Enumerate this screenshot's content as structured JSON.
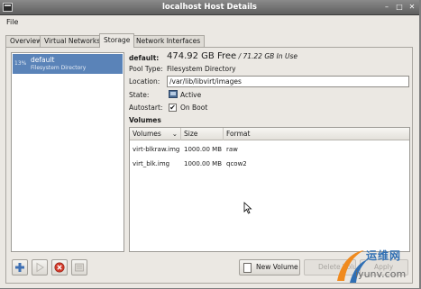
{
  "window": {
    "title": "localhost Host Details"
  },
  "menubar": {
    "file": "File"
  },
  "tabs": [
    {
      "label": "Overview"
    },
    {
      "label": "Virtual Networks"
    },
    {
      "label": "Storage"
    },
    {
      "label": "Network Interfaces"
    }
  ],
  "active_tab": "Storage",
  "pools": [
    {
      "usage": "13%",
      "name": "default",
      "type": "Filesystem Directory"
    }
  ],
  "details": {
    "name_label": "default:",
    "size_free": "474.92 GB Free",
    "size_usage": " / 71.22 GB In Use",
    "pool_type_label": "Pool Type:",
    "pool_type_value": "Filesystem Directory",
    "location_label": "Location:",
    "location_value": "/var/lib/libvirt/images",
    "state_label": "State:",
    "state_value": "Active",
    "autostart_label": "Autostart:",
    "autostart_value": "On Boot",
    "autostart_checked": "✔",
    "volumes_label": "Volumes"
  },
  "volumes": {
    "columns": [
      "Volumes",
      "Size",
      "Format"
    ],
    "rows": [
      {
        "name": "virt-blkraw.img",
        "size": "1000.00 MB",
        "format": "raw"
      },
      {
        "name": "virt_blk.img",
        "size": "1000.00 MB",
        "format": "qcow2"
      }
    ]
  },
  "buttons": {
    "new_volume": "New Volume",
    "delete_volume": "Delete Volume",
    "apply": "Apply"
  },
  "watermark": {
    "text_cn": "运维网",
    "url": "iyunv.com"
  },
  "colors": {
    "selection": "#5a83b8",
    "titlebar": "#6e6e6e",
    "window_bg": "#ebe8e3"
  }
}
